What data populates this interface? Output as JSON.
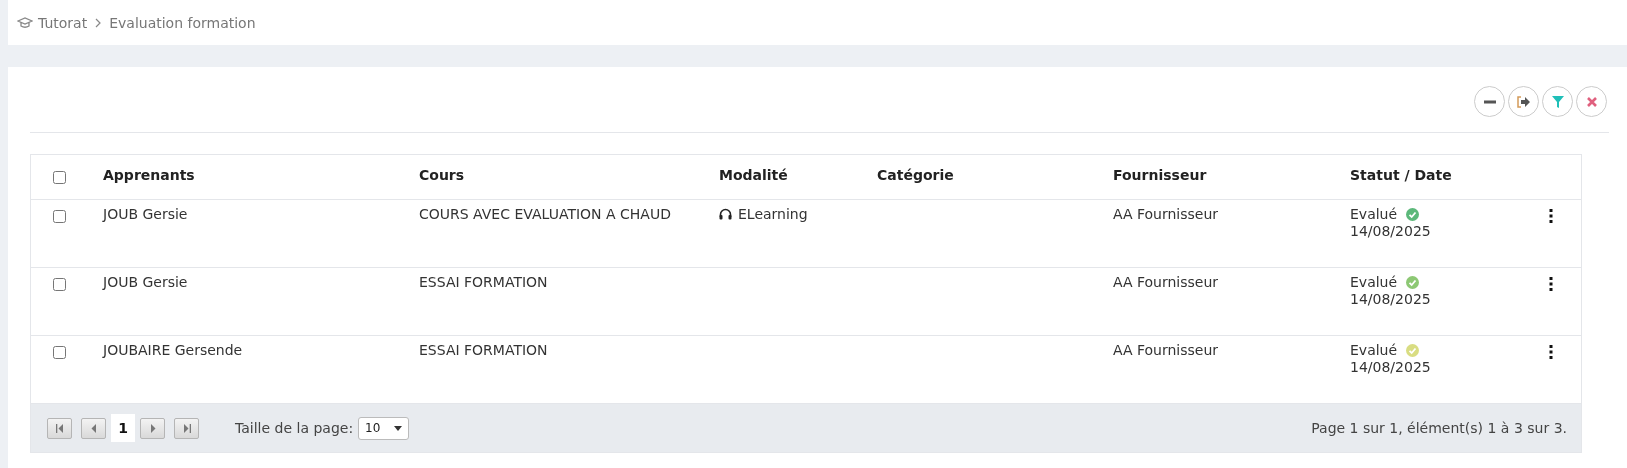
{
  "breadcrumb": [
    {
      "label": "Tutorat"
    },
    {
      "label": "Evaluation formation"
    }
  ],
  "toolbar": [
    {
      "kind": "collapse"
    },
    {
      "kind": "export"
    },
    {
      "kind": "filter"
    },
    {
      "kind": "clear"
    }
  ],
  "table": {
    "select_all": {
      "checked": false
    },
    "columns": [
      "Apprenants",
      "Cours",
      "Modalité",
      "Catégorie",
      "Fournisseur",
      "Statut / Date"
    ],
    "rows": [
      {
        "checked": false,
        "learner": "JOUB Gersie",
        "course": "COURS AVEC EVALUATION A CHAUD",
        "modality": "ELearning",
        "supplier": "AA Fournisseur",
        "status": "Evalué",
        "color": "#5cb87a",
        "date": "14/08/2025"
      },
      {
        "checked": false,
        "learner": "JOUB Gersie",
        "course": "ESSAI FORMATION",
        "supplier": "AA Fournisseur",
        "status": "Evalué",
        "color": "#8dc874",
        "date": "14/08/2025"
      },
      {
        "checked": false,
        "learner": "JOUBAIRE Gersende",
        "course": "ESSAI FORMATION",
        "supplier": "AA Fournisseur",
        "status": "Evalué",
        "color": "#d9dd82",
        "date": "14/08/2025"
      }
    ]
  },
  "pager": {
    "current_page": "1",
    "page_size_label": "Taille de la page:",
    "page_size": "10",
    "summary": "Page 1 sur 1, élément(s) 1 à 3 sur 3."
  }
}
